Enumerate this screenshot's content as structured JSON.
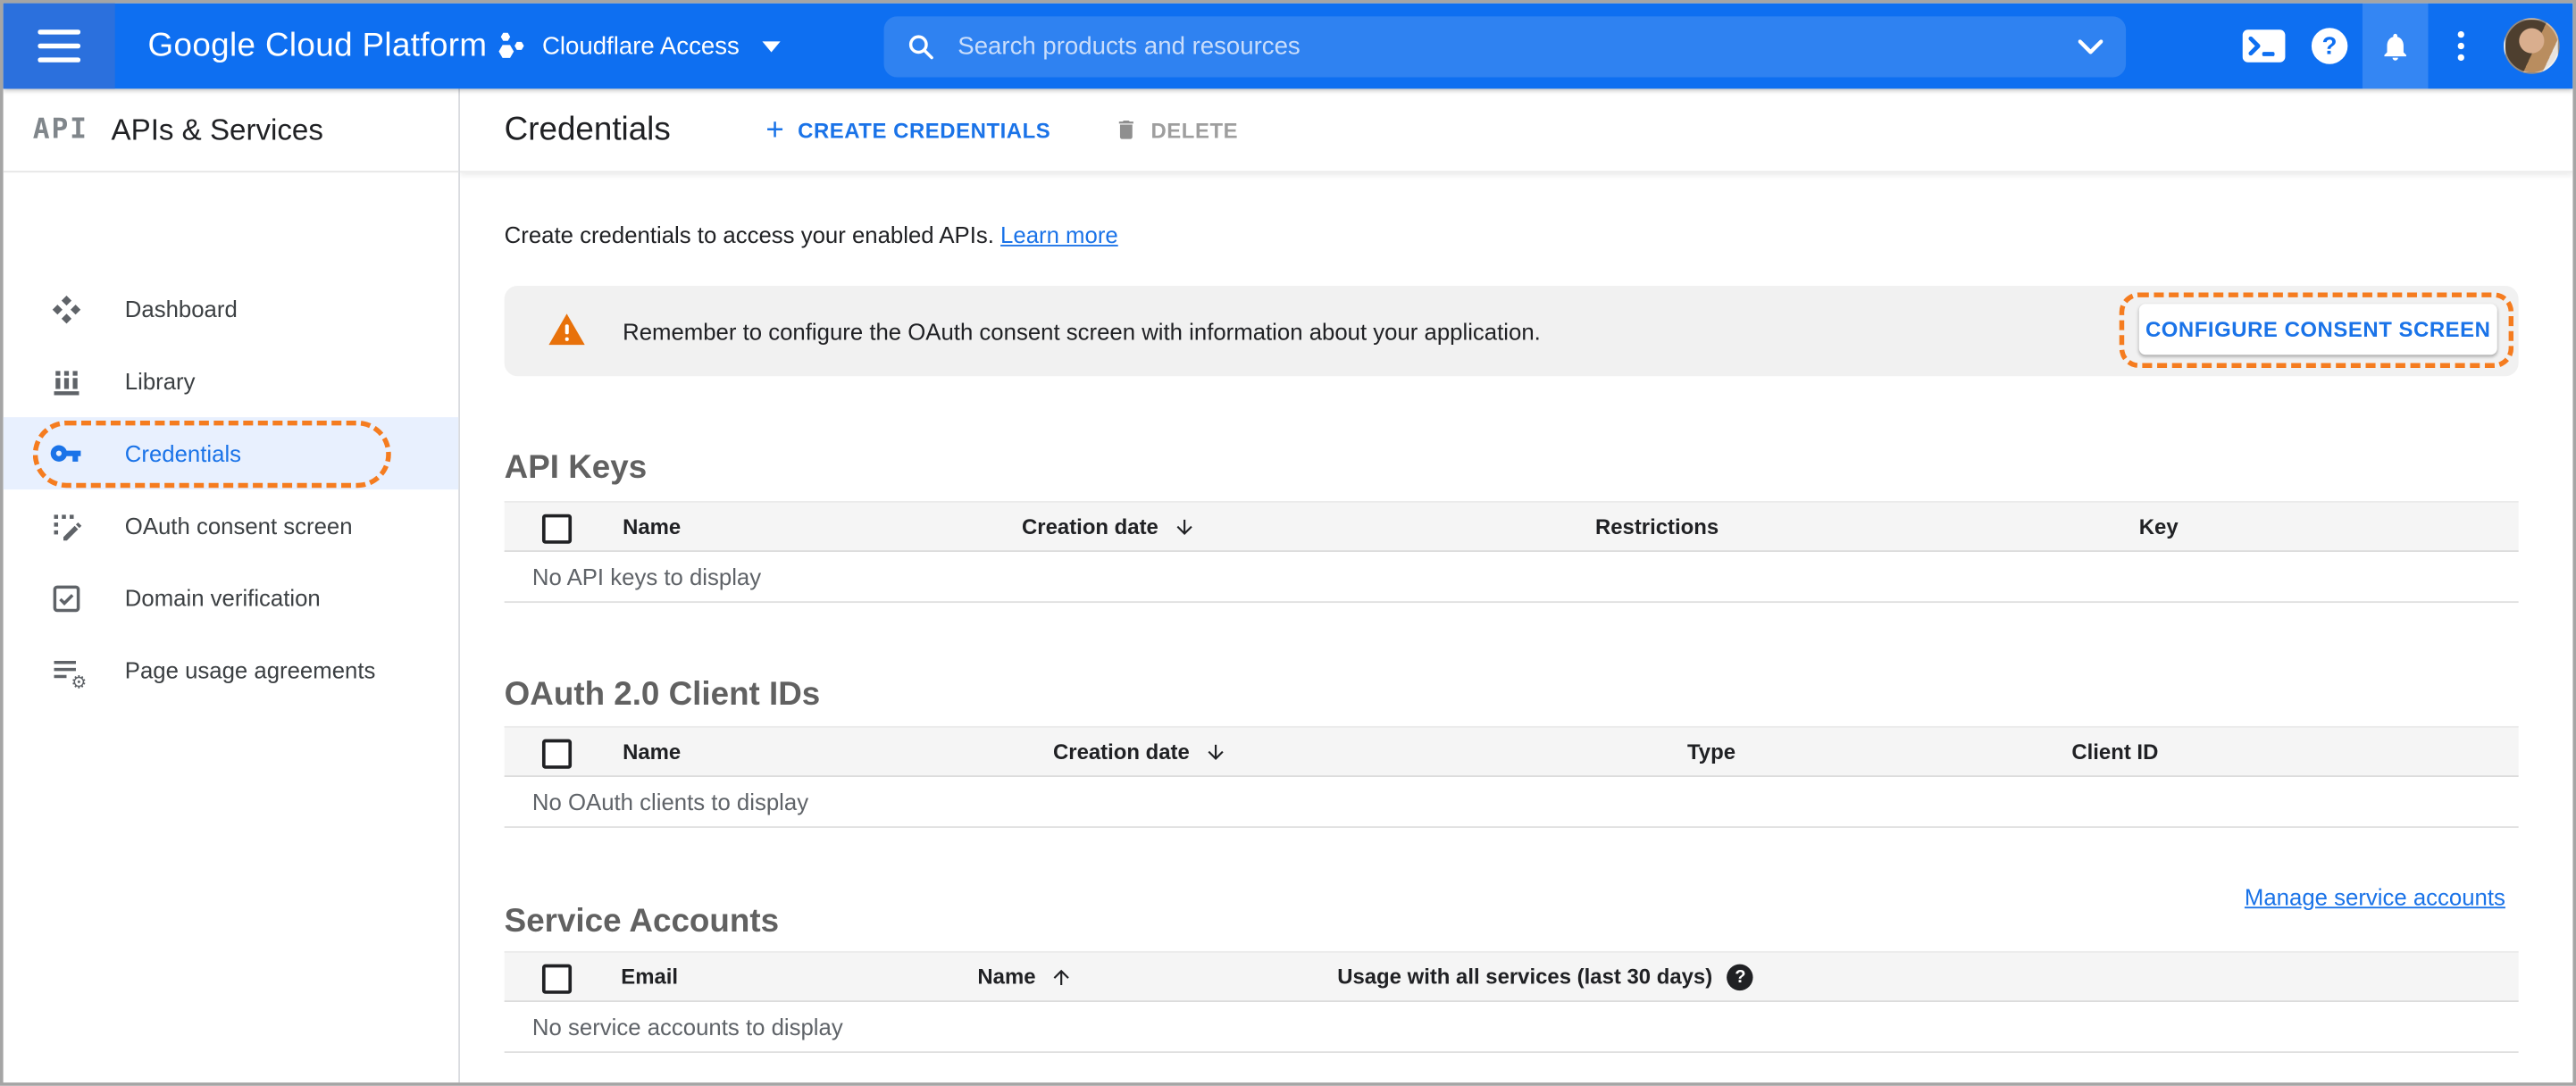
{
  "topbar": {
    "product_name": "Google Cloud Platform",
    "project_selector": {
      "label": "Cloudflare Access"
    },
    "search": {
      "placeholder": "Search products and resources"
    }
  },
  "sidebar": {
    "header": {
      "icon_text": "API",
      "title": "APIs & Services"
    },
    "items": [
      {
        "label": "Dashboard",
        "icon": "dashboard-icon",
        "active": false
      },
      {
        "label": "Library",
        "icon": "library-icon",
        "active": false
      },
      {
        "label": "Credentials",
        "icon": "key-icon",
        "active": true,
        "annotated": true
      },
      {
        "label": "OAuth consent screen",
        "icon": "consent-icon",
        "active": false
      },
      {
        "label": "Domain verification",
        "icon": "domain-verification-icon",
        "active": false
      },
      {
        "label": "Page usage agreements",
        "icon": "page-usage-icon",
        "active": false
      }
    ]
  },
  "header": {
    "title": "Credentials",
    "create_plus": "+",
    "create_button": "CREATE CREDENTIALS",
    "delete_button": "DELETE"
  },
  "intro": {
    "text": "Create credentials to access your enabled APIs. ",
    "link": "Learn more"
  },
  "banner": {
    "message": "Remember to configure the OAuth consent screen with information about your application.",
    "button": "CONFIGURE CONSENT SCREEN"
  },
  "sections": {
    "api_keys": {
      "title": "API Keys",
      "columns": [
        "Name",
        "Creation date",
        "Restrictions",
        "Key"
      ],
      "sort": {
        "column": "Creation date",
        "direction": "desc"
      },
      "empty": "No API keys to display"
    },
    "oauth_clients": {
      "title": "OAuth 2.0 Client IDs",
      "columns": [
        "Name",
        "Creation date",
        "Type",
        "Client ID"
      ],
      "sort": {
        "column": "Creation date",
        "direction": "desc"
      },
      "empty": "No OAuth clients to display"
    },
    "service_accounts": {
      "title": "Service Accounts",
      "manage_link": "Manage service accounts",
      "columns": [
        "Email",
        "Name",
        "Usage with all services (last 30 days)"
      ],
      "sort": {
        "column": "Name",
        "direction": "asc"
      },
      "help_glyph": "?",
      "empty": "No service accounts to display"
    }
  },
  "colors": {
    "topbar_blue": "#0e6ff1",
    "menu_square_blue": "#2b70dd",
    "search_pill_blue": "#2f82f1",
    "accent_blue": "#1a73e8",
    "active_row_bg": "#e8f0fe",
    "warning_orange": "#e8710a",
    "annotation_orange": "#f57c1f",
    "banner_gray": "#f1f1f1",
    "table_header_gray": "#f5f5f5"
  }
}
